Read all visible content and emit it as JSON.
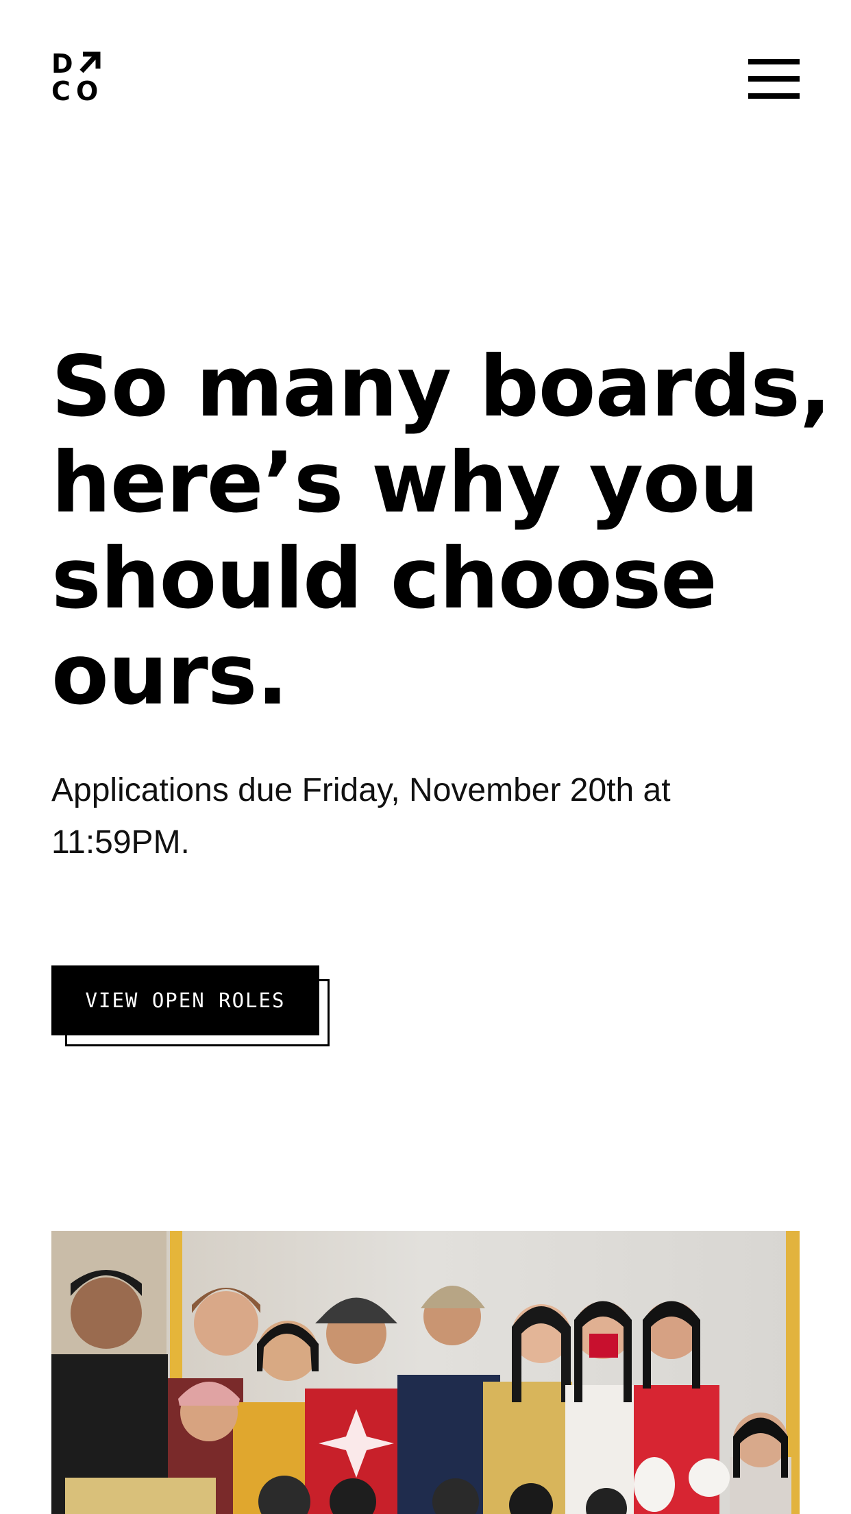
{
  "logo": {
    "letters": [
      "D",
      "C",
      "O"
    ],
    "arrow_icon": "arrow-up-right-icon"
  },
  "nav": {
    "menu_icon": "hamburger-menu-icon"
  },
  "hero": {
    "headline_lines": [
      "So many boards,",
      "here’s why you",
      "should choose",
      "ours."
    ],
    "subline_lines": [
      "Applications due Friday, November 20th at",
      "11:59PM."
    ]
  },
  "cta": {
    "label": "VIEW OPEN ROLES"
  },
  "photo": {
    "subject": "group-photo"
  },
  "colors": {
    "text": "#000000",
    "background": "#ffffff",
    "button_bg": "#000000",
    "button_text": "#ffffff"
  }
}
